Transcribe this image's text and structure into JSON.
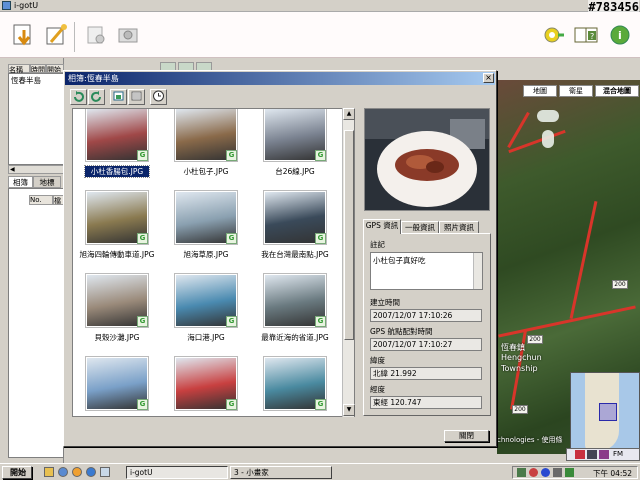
{
  "window": {
    "title": "i-gotU",
    "watermark": "#783456"
  },
  "toolbar": {
    "icons": [
      "import-icon",
      "magic-icon",
      "print-icon",
      "camera-icon",
      "settings-icon",
      "help-icon",
      "info-icon"
    ]
  },
  "left_panel": {
    "grid_headers": [
      "名稱",
      "時間",
      "開始時間"
    ],
    "grid_row": "恆春半島",
    "tabs": [
      "相簿",
      "地標"
    ],
    "list_header_no": "No.",
    "list_header_col": "檔"
  },
  "map": {
    "tabs": [
      "地圖",
      "衛星",
      "混合地圖"
    ],
    "place_cn": "恆春鎮",
    "place_en_1": "Hengchun",
    "place_en_2": "Township",
    "road_labels": [
      "200",
      "200",
      "200"
    ],
    "credit": "chnologies - 使用條",
    "scale_text": "FM"
  },
  "dialog": {
    "title": "相簿:恆春半島",
    "close_symbol": "×",
    "photos": [
      {
        "caption": "小杜香腸包.JPG",
        "selected": true,
        "color": "#a04848"
      },
      {
        "caption": "小杜包子.JPG",
        "selected": false,
        "color": "#8a6a4a"
      },
      {
        "caption": "台26線.JPG",
        "selected": false,
        "color": "#7a8290"
      },
      {
        "caption": "旭海四輪傳動車道.JPG",
        "selected": false,
        "color": "#8a7a50"
      },
      {
        "caption": "旭海草原.JPG",
        "selected": false,
        "color": "#8aa0b0"
      },
      {
        "caption": "我在台灣最南點.JPG",
        "selected": false,
        "color": "#3a4a5a"
      },
      {
        "caption": "貝殼沙灘.JPG",
        "selected": false,
        "color": "#9a8a7a"
      },
      {
        "caption": "海口港.JPG",
        "selected": false,
        "color": "#4a8ab0"
      },
      {
        "caption": "最靠近海的省道.JPG",
        "selected": false,
        "color": "#6a7a80"
      },
      {
        "caption": "",
        "selected": false,
        "color": "#7aa0c8"
      },
      {
        "caption": "",
        "selected": false,
        "color": "#c84040"
      },
      {
        "caption": "",
        "selected": false,
        "color": "#4a8aa0"
      }
    ],
    "info_tabs": [
      "GPS 資訊",
      "一般資訊",
      "照片資訊"
    ],
    "note_label": "註記",
    "note_value": "小杜包子真好吃",
    "created_label": "建立時間",
    "created_value": "2007/12/07 17:10:26",
    "gps_time_label": "GPS 航點配對時間",
    "gps_time_value": "2007/12/07 17:10:27",
    "lat_label": "緯度",
    "lat_value": "北緯 21.992",
    "lon_label": "經度",
    "lon_value": "東經 120.747",
    "close_button": "關閉"
  },
  "taskbar": {
    "start": "開始",
    "tasks": [
      {
        "label": "i-gotU",
        "active": true
      },
      {
        "label": "3 - 小畫家",
        "active": false
      }
    ],
    "clock": "下午 04:52"
  }
}
